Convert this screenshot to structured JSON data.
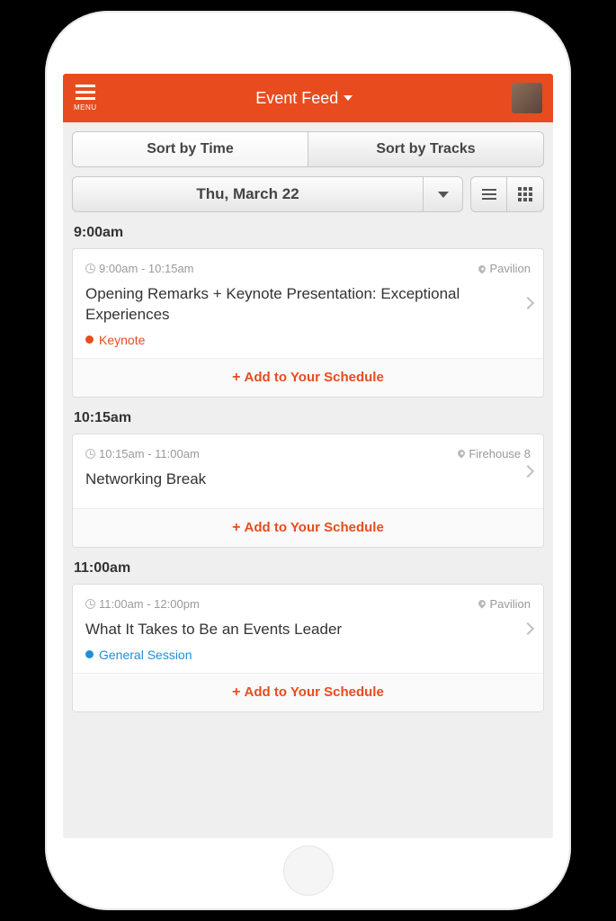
{
  "header": {
    "menu_label": "MENU",
    "title": "Event Feed"
  },
  "sort_tabs": {
    "by_time": "Sort by Time",
    "by_tracks": "Sort by Tracks"
  },
  "date_selector": {
    "label": "Thu, March 22"
  },
  "add_schedule_label": "Add to Your Schedule",
  "track_colors": {
    "keynote": "#e84c1e",
    "general": "#1e8fd6"
  },
  "groups": [
    {
      "time_label": "9:00am",
      "session": {
        "time_range": "9:00am - 10:15am",
        "location": "Pavilion",
        "title": "Opening Remarks + Keynote Presentation: Exceptional Experiences",
        "track_label": "Keynote",
        "track_color_key": "keynote"
      }
    },
    {
      "time_label": "10:15am",
      "session": {
        "time_range": "10:15am - 11:00am",
        "location": "Firehouse 8",
        "title": "Networking Break",
        "track_label": "",
        "track_color_key": ""
      }
    },
    {
      "time_label": "11:00am",
      "session": {
        "time_range": "11:00am - 12:00pm",
        "location": "Pavilion",
        "title": "What It Takes to Be an Events Leader",
        "track_label": "General Session",
        "track_color_key": "general"
      }
    }
  ]
}
